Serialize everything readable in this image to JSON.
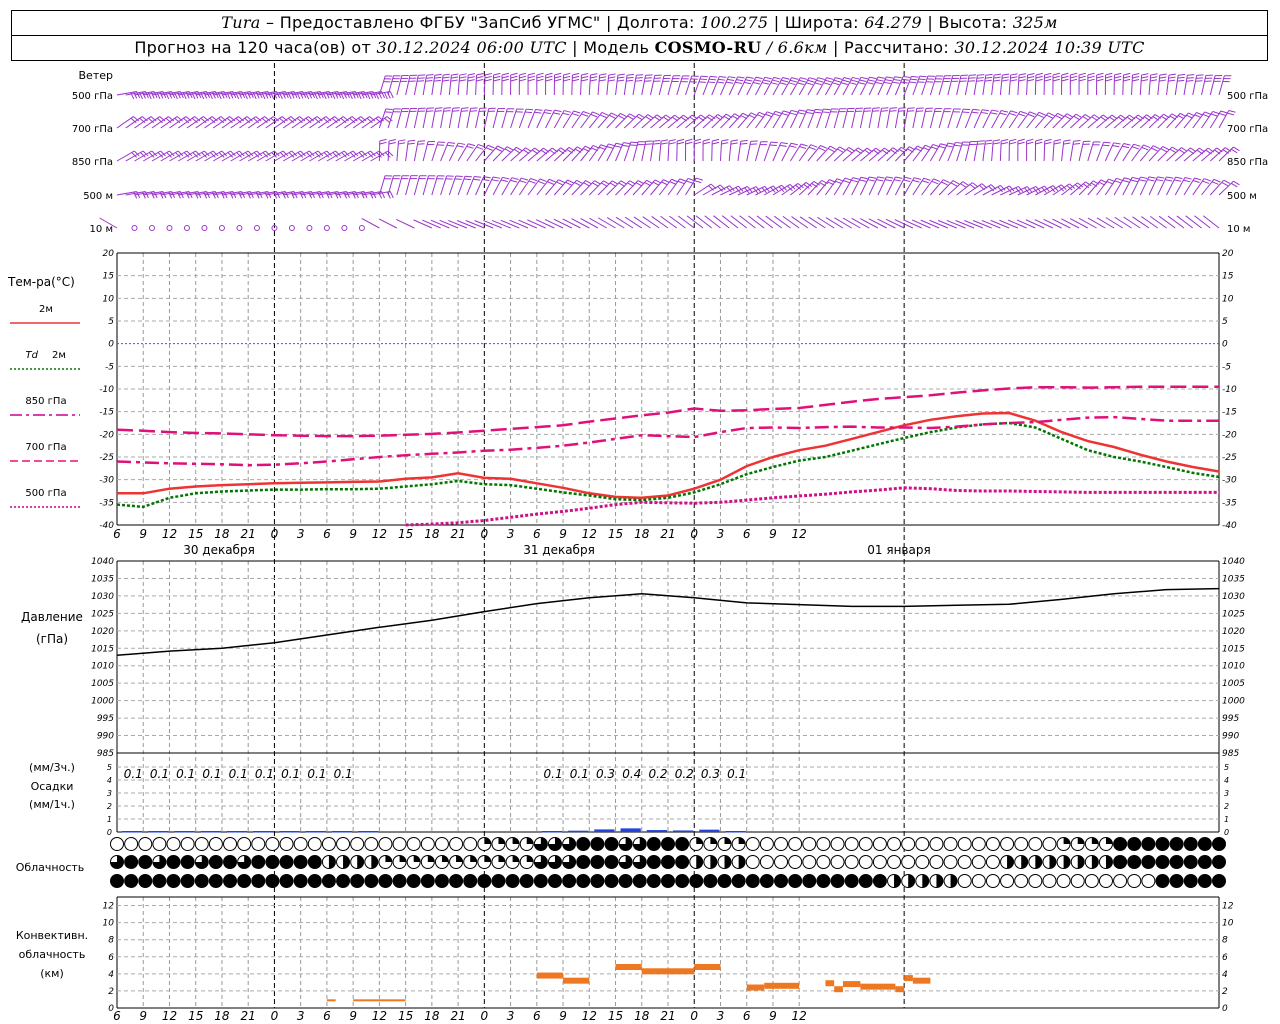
{
  "header": {
    "station": "Tura",
    "provider": " – Предоставлено ФГБУ \"ЗапСиб УГМС\" | Долгота: ",
    "lon": "100.275",
    "lat_label": " | Широта: ",
    "lat": "64.279",
    "alt_label": " | Высота: ",
    "alt": "325м",
    "forecast_prefix": "Прогноз на 120 часа(ов) от ",
    "forecast_start": "30.12.2024 06:00 UTC",
    "model_label": " | Модель ",
    "model": "COSMO-RU",
    "resolution": " / 6.6км",
    "calc_label": " | Рассчитано: ",
    "calc_time": "30.12.2024 10:39 UTC"
  },
  "wind_panel": {
    "title": "Ветер",
    "levels": [
      "500 гПа",
      "700 гПа",
      "850 гПа",
      "500 м",
      "10 м"
    ],
    "color": "#9933cc"
  },
  "temp_panel": {
    "title": "Тем-ра(°С)",
    "y_ticks": [
      20,
      15,
      10,
      5,
      0,
      -5,
      -10,
      -15,
      -20,
      -25,
      -30,
      -35,
      -40
    ],
    "legend": [
      {
        "label": "2м",
        "color": "#ee3333",
        "style": "solid"
      },
      {
        "label_it": "Td",
        "label": "2м",
        "color": "#007700",
        "style": "dotted"
      },
      {
        "label": "850 гПа",
        "color": "#cc0099",
        "style": "dashdot"
      },
      {
        "label": "700 гПа",
        "color": "#ee1177",
        "style": "dashed"
      },
      {
        "label": "500 гПа",
        "color": "#cc0099",
        "style": "dotted"
      }
    ]
  },
  "time_axis": {
    "hours": [
      "6",
      "9",
      "12",
      "15",
      "18",
      "21",
      "0",
      "3",
      "6",
      "9",
      "12",
      "15",
      "18",
      "21",
      "0",
      "3",
      "6",
      "9",
      "12",
      "15",
      "18",
      "21",
      "0",
      "3",
      "6",
      "9",
      "12"
    ],
    "days": [
      "30 декабря",
      "31 декабря",
      "01 января"
    ]
  },
  "pressure_panel": {
    "title": "Давление",
    "unit": "(гПа)",
    "y_ticks": [
      1040,
      1035,
      1030,
      1025,
      1020,
      1015,
      1010,
      1005,
      1000,
      995,
      990,
      985
    ]
  },
  "precip_panel": {
    "title1": "(мм/3ч.)",
    "title2": "Осадки",
    "title3": "(мм/1ч.)",
    "y_ticks": [
      5,
      4,
      3,
      2,
      1,
      0
    ],
    "labels": [
      {
        "h": 3,
        "v": "0.1"
      },
      {
        "h": 6,
        "v": "0.1"
      },
      {
        "h": 9,
        "v": "0.1"
      },
      {
        "h": 12,
        "v": "0.1"
      },
      {
        "h": 15,
        "v": "0.1"
      },
      {
        "h": 18,
        "v": "0.1"
      },
      {
        "h": 21,
        "v": "0.1"
      },
      {
        "h": 24,
        "v": "0.1"
      },
      {
        "h": 27,
        "v": "0.1"
      },
      {
        "h": 51,
        "v": "0.1"
      },
      {
        "h": 54,
        "v": "0.1"
      },
      {
        "h": 57,
        "v": "0.3"
      },
      {
        "h": 60,
        "v": "0.4"
      },
      {
        "h": 63,
        "v": "0.2"
      },
      {
        "h": 66,
        "v": "0.2"
      },
      {
        "h": 69,
        "v": "0.3"
      },
      {
        "h": 72,
        "v": "0.1"
      }
    ]
  },
  "cloud_panel": {
    "title": "Облачность"
  },
  "conv_panel": {
    "title1": "Конвективн.",
    "title2": "облачность",
    "title3": "(км)",
    "y_ticks": [
      12,
      10,
      8,
      6,
      4,
      2,
      0
    ]
  },
  "chart_data": [
    {
      "type": "line",
      "name": "temperature",
      "x_unit": "hours since 30.12.2024 06:00 UTC",
      "x": [
        0,
        3,
        6,
        9,
        12,
        15,
        18,
        21,
        24,
        27,
        30,
        33,
        36,
        39,
        42,
        45,
        48,
        51,
        54,
        57,
        60,
        63,
        66,
        69,
        72,
        75,
        78,
        81,
        84,
        87,
        90,
        93,
        96,
        99,
        102,
        105,
        108,
        111,
        114,
        117,
        120,
        123,
        126
      ],
      "series": [
        {
          "name": "2м",
          "values": [
            -33,
            -33,
            -32,
            -31.5,
            -31.2,
            -31,
            -30.8,
            -30.7,
            -30.6,
            -30.5,
            -30.4,
            -29.8,
            -29.5,
            -28.6,
            -29.6,
            -29.8,
            -30.8,
            -31.8,
            -33,
            -33.8,
            -34,
            -33.5,
            -32,
            -30,
            -27,
            -25,
            -23.5,
            -22.5,
            -21,
            -19.5,
            -18,
            -16.8,
            -16,
            -15.4,
            -15.3,
            -17,
            -19.5,
            -21.5,
            -22.8,
            -24.5,
            -26,
            -27.2,
            -28.2
          ]
        },
        {
          "name": "Td 2м",
          "values": [
            -35.5,
            -36,
            -34,
            -33,
            -32.6,
            -32.4,
            -32.2,
            -32.2,
            -32.1,
            -32.1,
            -32,
            -31.5,
            -31,
            -30.3,
            -31,
            -31.2,
            -32,
            -32.8,
            -33.5,
            -34.3,
            -34.5,
            -34,
            -32.8,
            -31,
            -28.8,
            -27.2,
            -25.8,
            -25,
            -23.6,
            -22.2,
            -20.8,
            -19.5,
            -18.5,
            -17.8,
            -17.5,
            -18.5,
            -21,
            -23.5,
            -25,
            -26,
            -27.2,
            -28.5,
            -29.4
          ]
        },
        {
          "name": "850 гПа",
          "values": [
            -26,
            -26.2,
            -26.4,
            -26.5,
            -26.6,
            -26.8,
            -26.7,
            -26.4,
            -26,
            -25.5,
            -25,
            -24.6,
            -24.3,
            -24,
            -23.6,
            -23.4,
            -23,
            -22.5,
            -21.8,
            -21,
            -20.2,
            -20.4,
            -20.6,
            -19.5,
            -18.6,
            -18.5,
            -18.6,
            -18.4,
            -18.3,
            -18.5,
            -18.5,
            -18.6,
            -18.3,
            -17.8,
            -17.5,
            -17.3,
            -16.8,
            -16.3,
            -16.2,
            -16.6,
            -17,
            -17,
            -17
          ]
        },
        {
          "name": "700 гПа",
          "values": [
            -19,
            -19.2,
            -19.5,
            -19.7,
            -19.8,
            -20,
            -20.2,
            -20.3,
            -20.4,
            -20.4,
            -20.3,
            -20.1,
            -19.9,
            -19.6,
            -19.2,
            -18.8,
            -18.4,
            -18,
            -17.2,
            -16.5,
            -15.8,
            -15.2,
            -14.3,
            -14.8,
            -14.7,
            -14.4,
            -14.2,
            -13.5,
            -12.8,
            -12.2,
            -11.8,
            -11.4,
            -10.8,
            -10.3,
            -9.9,
            -9.6,
            -9.6,
            -9.7,
            -9.6,
            -9.5,
            -9.5,
            -9.5,
            -9.5
          ]
        },
        {
          "name": "500 гПа",
          "values": [
            null,
            null,
            null,
            null,
            null,
            null,
            null,
            null,
            null,
            null,
            null,
            -40,
            -39.8,
            -39.5,
            -39,
            -38.3,
            -37.6,
            -37,
            -36.3,
            -35.5,
            -35,
            -35.1,
            -35.2,
            -35,
            -34.5,
            -34,
            -33.6,
            -33.2,
            -32.7,
            -32.3,
            -31.8,
            -32,
            -32.4,
            -32.5,
            -32.5,
            -32.6,
            -32.7,
            -32.8,
            -32.8,
            -32.8,
            -32.8,
            -32.8,
            -32.8
          ]
        }
      ],
      "ylim": [
        -40,
        20
      ]
    },
    {
      "type": "line",
      "name": "pressure",
      "x_unit": "hours since 30.12.2024 06:00 UTC",
      "x": [
        0,
        6,
        12,
        18,
        24,
        30,
        36,
        42,
        48,
        54,
        60,
        66,
        72,
        78,
        84,
        90,
        96,
        102,
        108,
        114,
        120,
        126
      ],
      "series": [
        {
          "name": "Давление",
          "values": [
            1013,
            1014.2,
            1015,
            1016.6,
            1018.8,
            1021,
            1023,
            1025.5,
            1027.8,
            1029.5,
            1030.6,
            1029.5,
            1028,
            1027.5,
            1027,
            1027,
            1027.3,
            1027.6,
            1029,
            1030.6,
            1031.8,
            1032.1
          ]
        }
      ],
      "ylim": [
        985,
        1040
      ]
    },
    {
      "type": "bar",
      "name": "precipitation_1h",
      "x_unit": "hours since 30.12.2024 06:00 UTC",
      "x": [
        3,
        6,
        9,
        12,
        15,
        18,
        21,
        24,
        27,
        30,
        51,
        54,
        57,
        60,
        63,
        66,
        69,
        72
      ],
      "values": [
        0.03,
        0.03,
        0.03,
        0.03,
        0.03,
        0.03,
        0.03,
        0.03,
        0.03,
        0.03,
        0.05,
        0.1,
        0.2,
        0.28,
        0.15,
        0.12,
        0.18,
        0.05
      ],
      "ylim": [
        0,
        5
      ]
    },
    {
      "type": "bar",
      "name": "convective_cloud_km",
      "x_unit": "hours since 30.12.2024 06:00 UTC",
      "segments": [
        {
          "x0": 24,
          "x1": 25,
          "y": 0.9
        },
        {
          "x0": 27,
          "x1": 33,
          "y": 0.9
        },
        {
          "x0": 48,
          "x1": 51,
          "y": 3.8
        },
        {
          "x0": 51,
          "x1": 54,
          "y": 3.2
        },
        {
          "x0": 57,
          "x1": 60,
          "y": 4.8
        },
        {
          "x0": 60,
          "x1": 66,
          "y": 4.3
        },
        {
          "x0": 66,
          "x1": 69,
          "y": 4.8
        },
        {
          "x0": 72,
          "x1": 74,
          "y": 2.4
        },
        {
          "x0": 74,
          "x1": 78,
          "y": 2.6
        },
        {
          "x0": 81,
          "x1": 82,
          "y": 2.9
        },
        {
          "x0": 82,
          "x1": 83,
          "y": 2.2
        },
        {
          "x0": 83,
          "x1": 85,
          "y": 2.8
        },
        {
          "x0": 85,
          "x1": 89,
          "y": 2.5
        },
        {
          "x0": 89,
          "x1": 90,
          "y": 2.2
        },
        {
          "x0": 90,
          "x1": 91,
          "y": 3.5
        },
        {
          "x0": 91,
          "x1": 93,
          "y": 3.2
        }
      ],
      "ylim": [
        0,
        13
      ]
    }
  ]
}
